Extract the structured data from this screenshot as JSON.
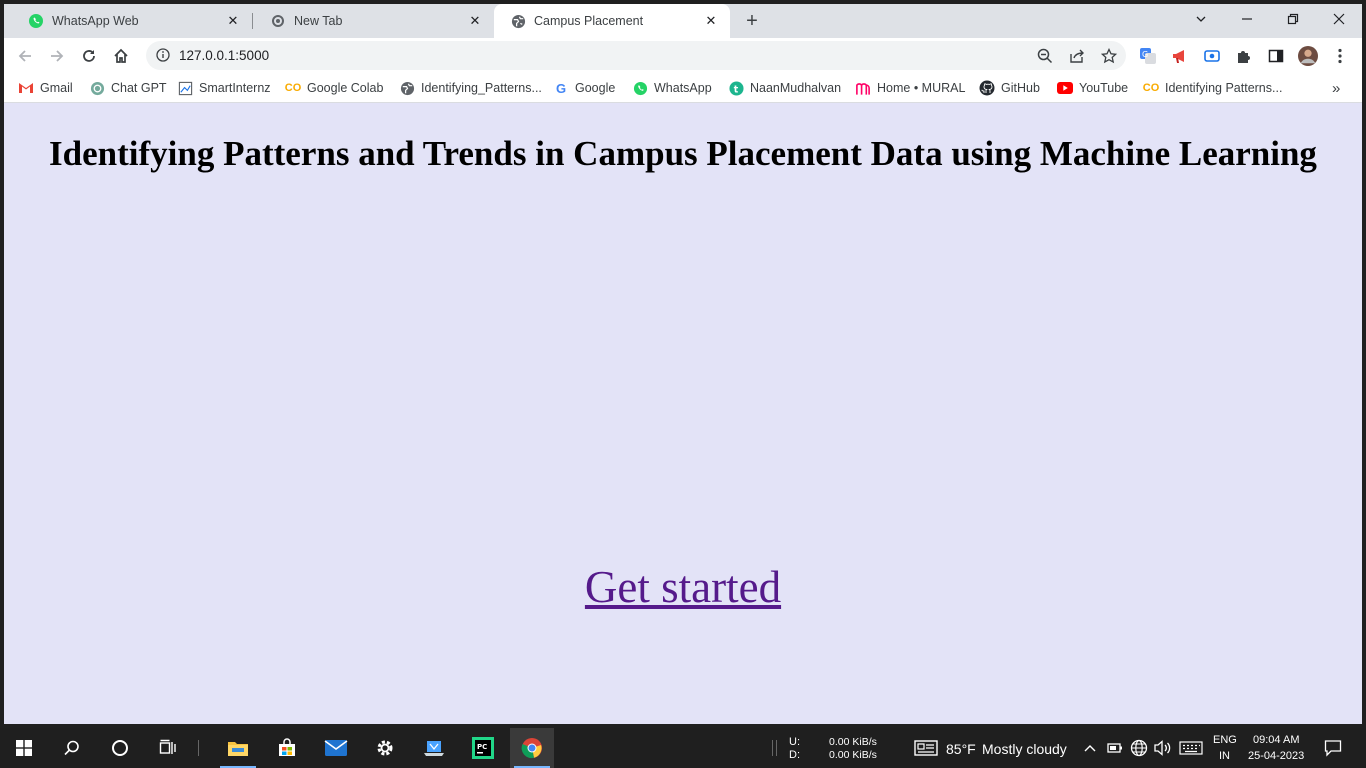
{
  "browser": {
    "tabs": [
      {
        "label": "WhatsApp Web",
        "icon": "whatsapp-icon"
      },
      {
        "label": "New Tab",
        "icon": "chrome-newtab-icon"
      },
      {
        "label": "Campus Placement",
        "icon": "globe-icon",
        "active": true
      }
    ],
    "address": "127.0.0.1:5000",
    "bookmarks": [
      {
        "label": "Gmail",
        "icon": "gmail-icon"
      },
      {
        "label": "Chat GPT",
        "icon": "chatgpt-icon"
      },
      {
        "label": "SmartInternz",
        "icon": "smartinternz-icon"
      },
      {
        "label": "Google Colab",
        "icon": "colab-icon"
      },
      {
        "label": "Identifying_Patterns...",
        "icon": "globe-icon"
      },
      {
        "label": "Google",
        "icon": "google-icon"
      },
      {
        "label": "WhatsApp",
        "icon": "whatsapp-icon"
      },
      {
        "label": "NaanMudhalvan",
        "icon": "naanmudhalvan-icon"
      },
      {
        "label": "Home • MURAL",
        "icon": "mural-icon"
      },
      {
        "label": "GitHub",
        "icon": "github-icon"
      },
      {
        "label": "YouTube",
        "icon": "youtube-icon"
      },
      {
        "label": "Identifying Patterns...",
        "icon": "colab-icon"
      }
    ],
    "overflow": "»"
  },
  "page": {
    "heading": "Identifying Patterns and Trends in Campus Placement Data using Machine Learning",
    "cta_link": "Get started",
    "background": "#e3e3f7",
    "link_color": "#551a8b"
  },
  "taskbar": {
    "network": {
      "up_label": "U:",
      "down_label": "D:",
      "up": "0.00 KiB/s",
      "down": "0.00 KiB/s"
    },
    "weather": {
      "temp": "85°F",
      "condition": "Mostly cloudy"
    },
    "language": {
      "lang": "ENG",
      "region": "IN"
    },
    "clock": {
      "time": "09:04 AM",
      "date": "25-04-2023"
    }
  }
}
